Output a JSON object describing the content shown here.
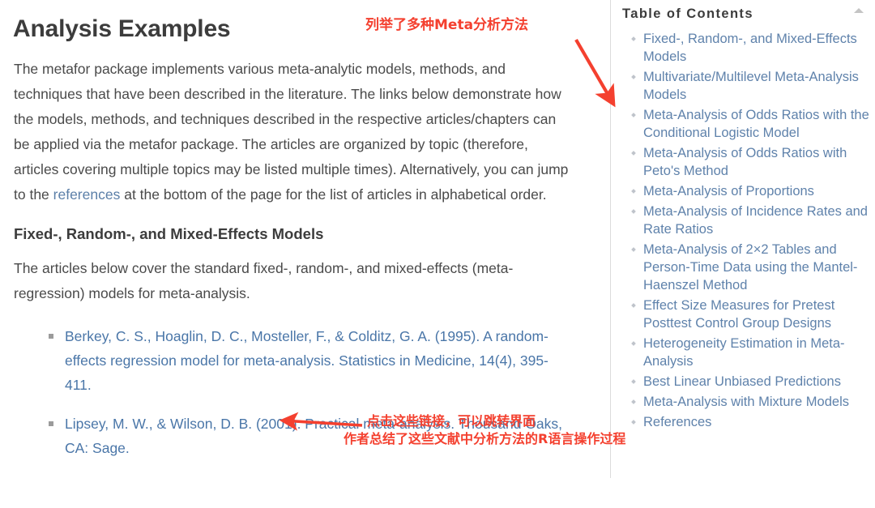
{
  "page": {
    "title": "Analysis Examples"
  },
  "intro": {
    "part1": "The metafor package implements various meta-analytic models, methods, and techniques that have been described in the literature. The links below demonstrate how the models, methods, and techniques described in the respective articles/chapters can be applied via the metafor package. The articles are organized by topic (therefore, articles covering multiple topics may be listed multiple times). Alternatively, you can jump to the ",
    "link_text": "references",
    "part2": " at the bottom of the page for the list of articles in alphabetical order."
  },
  "section": {
    "heading": "Fixed-, Random-, and Mixed-Effects Models",
    "paragraph": "The articles below cover the standard fixed-, random-, and mixed-effects (meta-regression) models for meta-analysis."
  },
  "references": [
    {
      "citation": "Berkey, C. S., Hoaglin, D. C., Mosteller, F., & Colditz, G. A. (1995). A random-effects regression model for meta-analysis. Statistics in Medicine, 14(4), 395-411."
    },
    {
      "citation": "Lipsey, M. W., & Wilson, D. B. (2001). Practical meta-analysis. Thousand Oaks, CA: Sage."
    }
  ],
  "toc": {
    "title": "Table of Contents",
    "collapse_icon": "chevron-up-icon",
    "items": [
      {
        "label": "Fixed-, Random-, and Mixed-Effects Models"
      },
      {
        "label": "Multivariate/Multilevel Meta-Analysis Models"
      },
      {
        "label": "Meta-Analysis of Odds Ratios with the Conditional Logistic Model"
      },
      {
        "label": "Meta-Analysis of Odds Ratios with Peto's Method"
      },
      {
        "label": "Meta-Analysis of Proportions"
      },
      {
        "label": "Meta-Analysis of Incidence Rates and Rate Ratios"
      },
      {
        "label": "Meta-Analysis of 2×2 Tables and Person-Time Data using the Mantel-Haenszel Method"
      },
      {
        "label": "Effect Size Measures for Pretest Posttest Control Group Designs"
      },
      {
        "label": "Heterogeneity Estimation in Meta-Analysis"
      },
      {
        "label": "Best Linear Unbiased Predictions"
      },
      {
        "label": "Meta-Analysis with Mixture Models"
      },
      {
        "label": "References"
      }
    ]
  },
  "annotations": {
    "top": "列举了多种Meta分析方法",
    "bottom_line1": "点击这些链接，可以跳转界面",
    "bottom_line2": "作者总结了这些文献中分析方法的R语言操作过程"
  },
  "colors": {
    "annotation_red": "#f4402f",
    "link_blue": "#4a76a8",
    "toc_link_blue": "#5f82ab",
    "heading_gray": "#3c3c3c",
    "body_gray": "#4a4a4a",
    "divider_gray": "#dcdcdc"
  }
}
